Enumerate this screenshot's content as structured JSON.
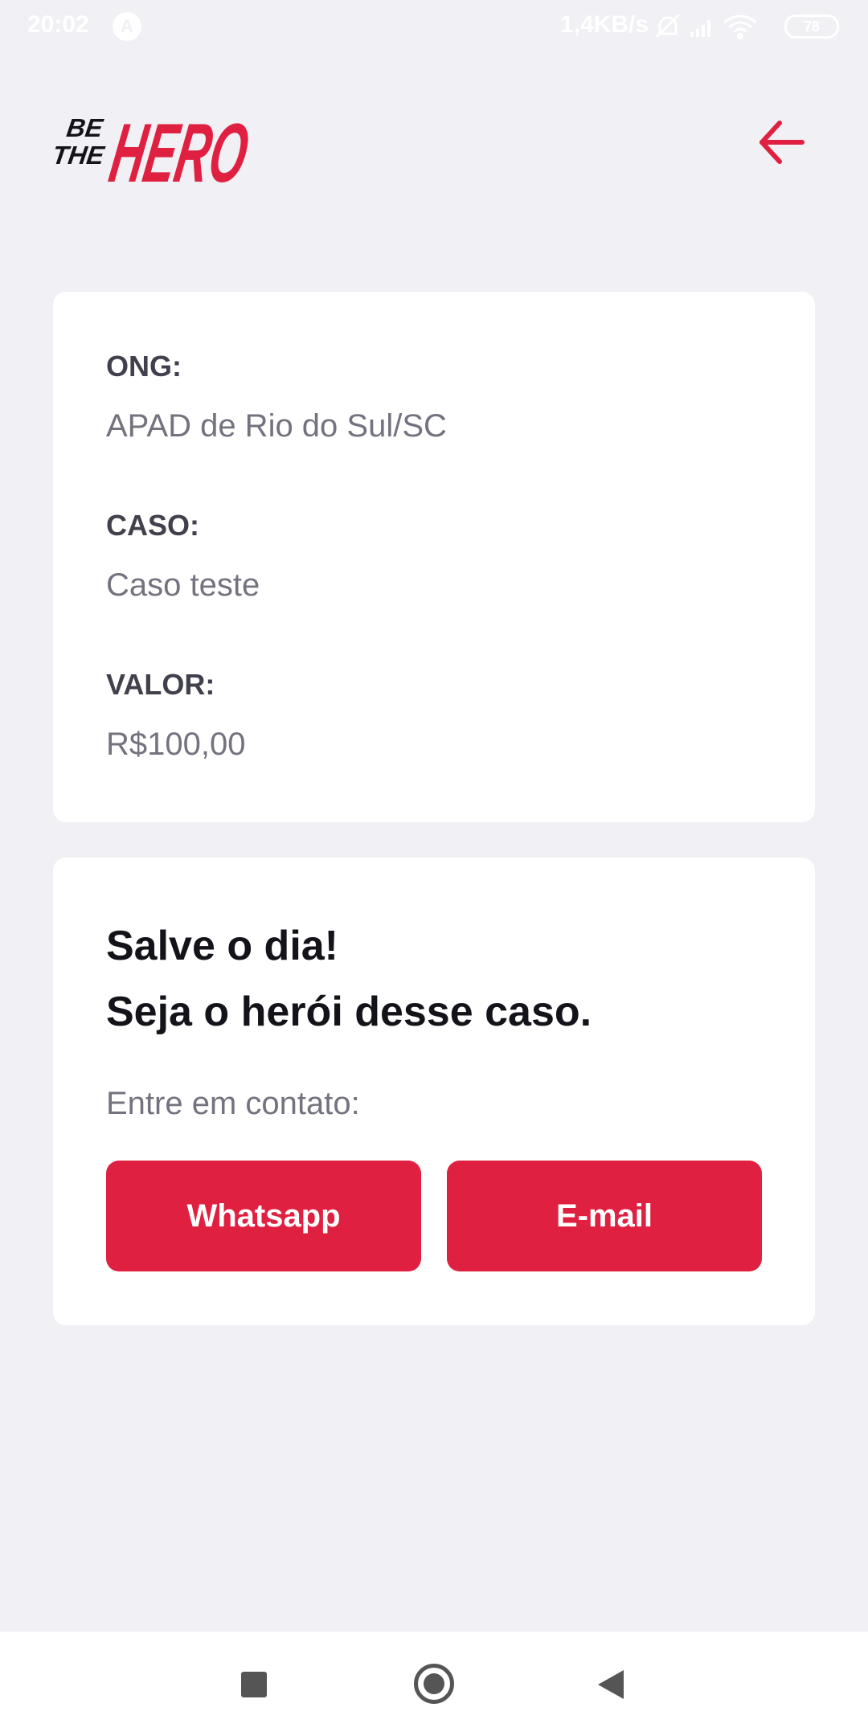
{
  "status_bar": {
    "time": "20:02",
    "a_icon_letter": "A",
    "speed": "1,4KB/s",
    "battery": "78"
  },
  "logo": {
    "small_top": "BE",
    "small_bottom": "THE",
    "big": "HERO"
  },
  "incident": {
    "ong_label": "ONG:",
    "ong_value": "APAD de Rio do Sul/SC",
    "case_label": "CASO:",
    "case_value": "Caso teste",
    "value_label": "VALOR:",
    "value_value": "R$100,00"
  },
  "contact": {
    "title_line1": "Salve o dia!",
    "title_line2": "Seja o herói desse caso.",
    "description": "Entre em contato:",
    "whatsapp_label": "Whatsapp",
    "email_label": "E-mail"
  },
  "colors": {
    "brand": "#e02041",
    "background": "#f0f0f5",
    "label": "#41414d",
    "value": "#737380"
  },
  "icons": {
    "back": "arrow-left-icon",
    "nav_recent": "square-icon",
    "nav_home": "circle-icon",
    "nav_back": "triangle-left-icon"
  }
}
